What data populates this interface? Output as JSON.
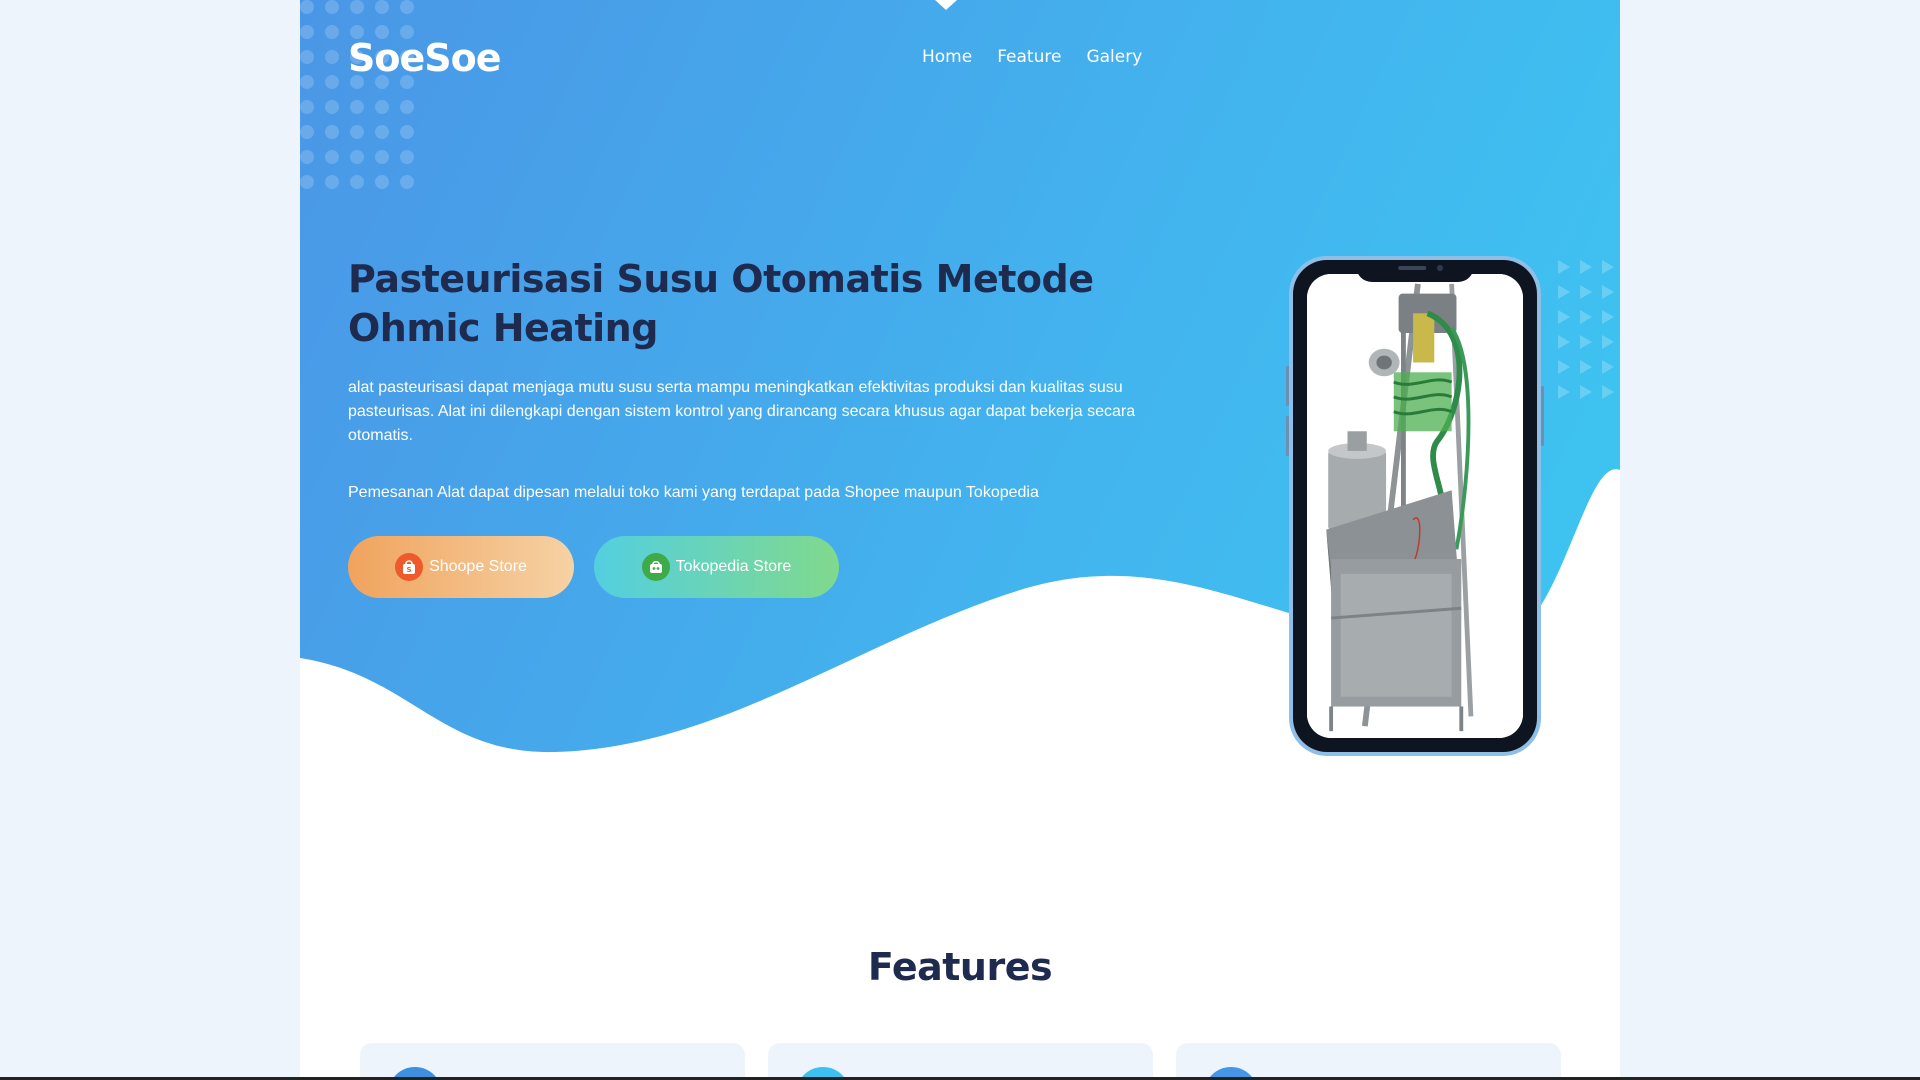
{
  "brand": {
    "logo_text": "SoeSoe"
  },
  "nav": {
    "items": [
      {
        "label": "Home"
      },
      {
        "label": "Feature"
      },
      {
        "label": "Galery"
      }
    ]
  },
  "hero": {
    "title": "Pasteurisasi Susu Otomatis Metode Ohmic Heating",
    "description": "alat pasteurisasi dapat menjaga mutu susu serta mampu meningkatkan efektivitas produksi dan kualitas susu pasteurisas. Alat ini dilengkapi dengan sistem kontrol yang dirancang secara khusus agar dapat bekerja secara otomatis.",
    "order_note": "Pemesanan Alat dapat dipesan melalui toko kami yang terdapat pada Shopee maupun Tokopedia",
    "buttons": {
      "shopee_label": "Shoope Store",
      "tokopedia_label": "Tokopedia Store"
    },
    "product_image": "milk-pasteurizer-machine"
  },
  "features": {
    "title": "Features"
  },
  "colors": {
    "hero_start": "#4a96e6",
    "hero_end": "#3dc7f1",
    "heading": "#1f2a4f",
    "shopee": "#ee5a2c",
    "tokopedia": "#3eab48"
  }
}
